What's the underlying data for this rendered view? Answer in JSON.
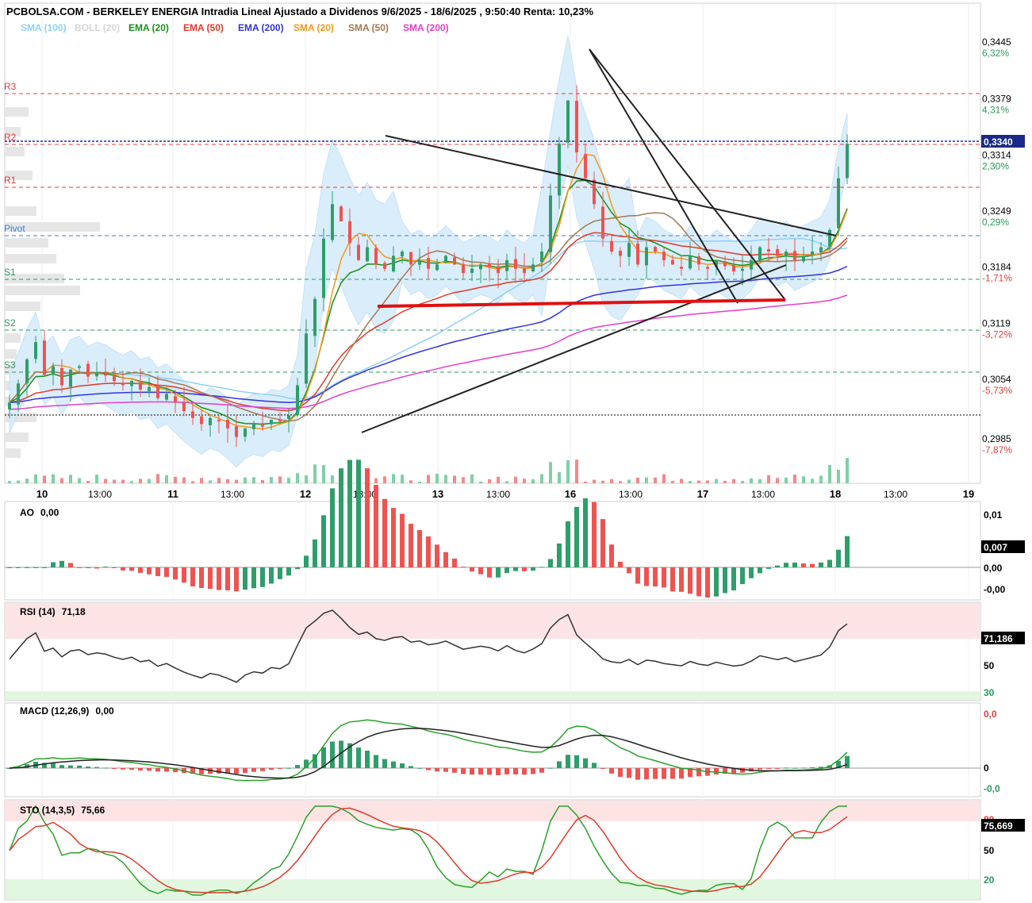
{
  "title": "PCBOLSA.COM - BERKELEY ENERGIA Intradia Lineal Ajustado a Dividenos 9/6/2025 - 18/6/2025 , 9:50:40 Renta: 10,23%",
  "legend": [
    {
      "label": "SMA (100)",
      "color": "#8fd0f5"
    },
    {
      "label": "BOLL (20)",
      "color": "#d6d6d6"
    },
    {
      "label": "EMA (20)",
      "color": "#1a8f1a"
    },
    {
      "label": "EMA (50)",
      "color": "#e03a2a"
    },
    {
      "label": "EMA (200)",
      "color": "#3333dd"
    },
    {
      "label": "SMA (20)",
      "color": "#f39a1c"
    },
    {
      "label": "SMA (50)",
      "color": "#a6784f"
    },
    {
      "label": "SMA (200)",
      "color": "#e33fc8"
    }
  ],
  "price_axis": [
    {
      "value": "0,3445",
      "pct": "6,32%",
      "pct_color": "#2a9a5a"
    },
    {
      "value": "0,3379",
      "pct": "4,31%",
      "pct_color": "#2a9a5a"
    },
    {
      "value": "0,3314",
      "pct": "2,30%",
      "pct_color": "#2a9a5a"
    },
    {
      "value": "0,3249",
      "pct": "0,29%",
      "pct_color": "#2a9a5a"
    },
    {
      "value": "0,3184",
      "pct": "-1,71%",
      "pct_color": "#e04040"
    },
    {
      "value": "0,3119",
      "pct": "-3,72%",
      "pct_color": "#e04040"
    },
    {
      "value": "0,3054",
      "pct": "-5,73%",
      "pct_color": "#e04040"
    },
    {
      "value": "0,2985",
      "pct": "-7,87%",
      "pct_color": "#e04040"
    }
  ],
  "current_price": "0,3340",
  "pivot_levels": [
    {
      "label": "R3",
      "color": "#e04040"
    },
    {
      "label": "R2",
      "color": "#e04040"
    },
    {
      "label": "R1",
      "color": "#e04040"
    },
    {
      "label": "Pivot",
      "color": "#3a7fd5"
    },
    {
      "label": "S1",
      "color": "#2a9a5a"
    },
    {
      "label": "S2",
      "color": "#2a9a5a"
    },
    {
      "label": "S3",
      "color": "#2a9a5a"
    }
  ],
  "x_axis": [
    {
      "label": "10",
      "bold": true
    },
    {
      "label": "13:00",
      "bold": false
    },
    {
      "label": "11",
      "bold": true
    },
    {
      "label": "13:00",
      "bold": false
    },
    {
      "label": "12",
      "bold": true
    },
    {
      "label": "13:00",
      "bold": false
    },
    {
      "label": "13",
      "bold": true
    },
    {
      "label": "13:00",
      "bold": false
    },
    {
      "label": "16",
      "bold": true
    },
    {
      "label": "13:00",
      "bold": false
    },
    {
      "label": "17",
      "bold": true
    },
    {
      "label": "13:00",
      "bold": false
    },
    {
      "label": "18",
      "bold": true
    },
    {
      "label": "13:00",
      "bold": false
    },
    {
      "label": "19",
      "bold": true
    }
  ],
  "indicators": {
    "ao": {
      "title": "AO",
      "value": "0,00",
      "axis": [
        "0,01",
        "0,00",
        "-0,00"
      ],
      "box": "0,007"
    },
    "rsi": {
      "title": "RSI (14)",
      "value": "71,18",
      "axis": [
        "50",
        "30"
      ],
      "box": "71,186"
    },
    "macd": {
      "title": "MACD (12,26,9)",
      "value": "0,00",
      "axis": [
        "0,0",
        "0",
        "-0,0"
      ]
    },
    "sto": {
      "title": "STO (14,3,5)",
      "value": "75,66",
      "axis": [
        "80",
        "50",
        "20"
      ],
      "box": "75,669"
    }
  },
  "colors": {
    "up": "#2e9e6a",
    "down": "#ef5350",
    "boll_fill": "#d7ecfb",
    "trend_red": "#e01010"
  },
  "chart_data": {
    "type": "candlestick",
    "ylim": [
      0.2985,
      0.3445
    ],
    "close_series": [
      0.304,
      0.3062,
      0.309,
      0.311,
      0.3072,
      0.3082,
      0.306,
      0.3078,
      0.3082,
      0.307,
      0.3075,
      0.3072,
      0.3065,
      0.306,
      0.3065,
      0.3055,
      0.3058,
      0.3045,
      0.305,
      0.304,
      0.303,
      0.3022,
      0.3015,
      0.3022,
      0.3018,
      0.301,
      0.3,
      0.301,
      0.3015,
      0.3012,
      0.302,
      0.3018,
      0.3025,
      0.306,
      0.312,
      0.316,
      0.323,
      0.327,
      0.325,
      0.3225,
      0.3205,
      0.322,
      0.32,
      0.3195,
      0.321,
      0.3215,
      0.32,
      0.3205,
      0.3195,
      0.32,
      0.321,
      0.32,
      0.319,
      0.3195,
      0.32,
      0.3197,
      0.319,
      0.3205,
      0.3195,
      0.319,
      0.32,
      0.3215,
      0.328,
      0.334,
      0.339,
      0.333,
      0.33,
      0.327,
      0.323,
      0.3215,
      0.321,
      0.3225,
      0.32,
      0.322,
      0.3215,
      0.3205,
      0.32,
      0.3195,
      0.321,
      0.32,
      0.3195,
      0.3205,
      0.3198,
      0.3192,
      0.3195,
      0.3205,
      0.322,
      0.3215,
      0.321,
      0.3215,
      0.3205,
      0.321,
      0.3215,
      0.322,
      0.324,
      0.33,
      0.334
    ],
    "series": [
      {
        "name": "SMA (100)",
        "color": "#8fd0f5"
      },
      {
        "name": "EMA (20)",
        "color": "#1a8f1a"
      },
      {
        "name": "EMA (50)",
        "color": "#e03a2a"
      },
      {
        "name": "EMA (200)",
        "color": "#3333dd"
      },
      {
        "name": "SMA (20)",
        "color": "#f39a1c"
      },
      {
        "name": "SMA (50)",
        "color": "#a6784f"
      },
      {
        "name": "SMA (200)",
        "color": "#e33fc8"
      }
    ],
    "rsi_last": 71.18,
    "sto_last": 75.66
  }
}
